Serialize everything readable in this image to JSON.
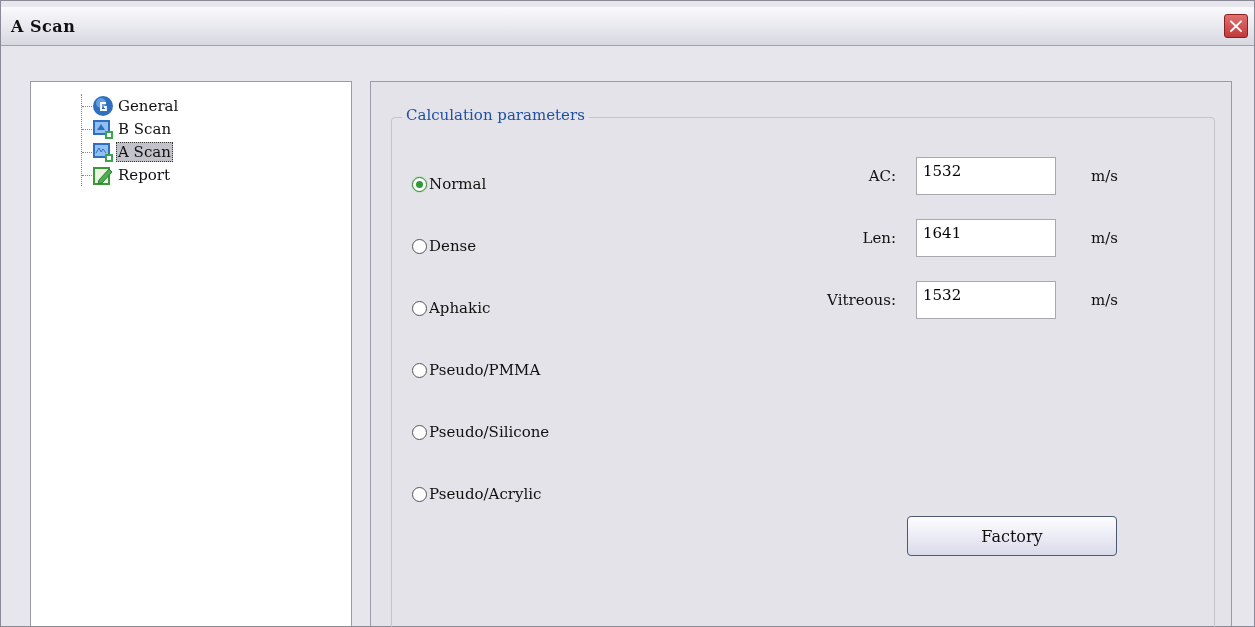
{
  "window": {
    "title": "A Scan",
    "close": "×"
  },
  "tree": {
    "items": [
      {
        "label": "General",
        "kind": "globe",
        "selected": false
      },
      {
        "label": "B Scan",
        "kind": "bscan",
        "selected": false
      },
      {
        "label": "A Scan",
        "kind": "ascan",
        "selected": true
      },
      {
        "label": "Report",
        "kind": "report",
        "selected": false
      }
    ]
  },
  "group": {
    "title": "Calculation parameters",
    "modes": [
      {
        "label": "Normal",
        "selected": true
      },
      {
        "label": "Dense",
        "selected": false
      },
      {
        "label": "Aphakic",
        "selected": false
      },
      {
        "label": "Pseudo/PMMA",
        "selected": false
      },
      {
        "label": "Pseudo/Silicone",
        "selected": false
      },
      {
        "label": "Pseudo/Acrylic",
        "selected": false
      }
    ],
    "fields": [
      {
        "label": "AC:",
        "value": "1532",
        "unit": "m/s"
      },
      {
        "label": "Len:",
        "value": "1641",
        "unit": "m/s"
      },
      {
        "label": "Vitreous:",
        "value": "1532",
        "unit": "m/s"
      }
    ],
    "button": "Factory"
  }
}
